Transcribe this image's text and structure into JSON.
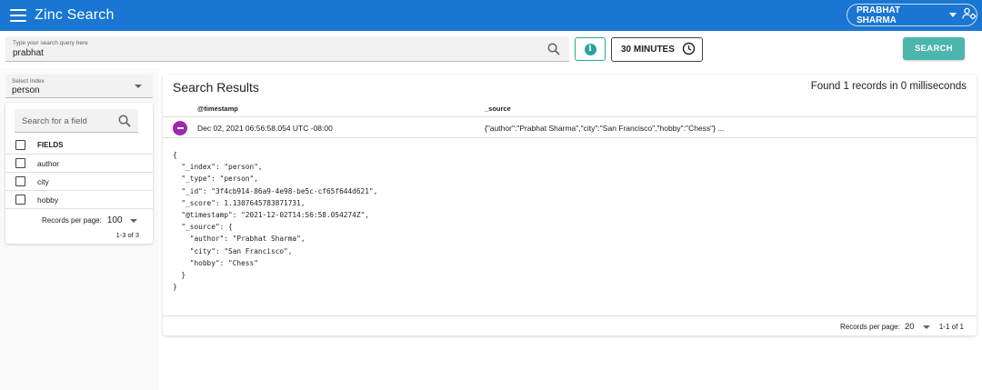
{
  "header": {
    "app_title": "Zinc Search",
    "menu_icon": "hamburger-menu-icon",
    "user_name": "PRABHAT SHARMA",
    "user_icon": "manage-accounts-icon",
    "bar_color": "#1976d2"
  },
  "query": {
    "label": "Type your search query here",
    "value": "prabhat",
    "search_icon": "search-icon"
  },
  "toolbar": {
    "info_icon": "info-icon",
    "info_glyph": "i",
    "time_range": "30 MINUTES",
    "time_icon": "clock-icon",
    "search_label": "SEARCH",
    "accent_color": "#26a69a"
  },
  "index": {
    "label": "Select Index",
    "value": "person"
  },
  "fields": {
    "search_placeholder": "Search for a field",
    "header": "FIELDS",
    "items": [
      "author",
      "city",
      "hobby"
    ],
    "rows_per_page_label": "Records per page:",
    "rows_per_page_value": "100",
    "range": "1-3 of 3"
  },
  "results": {
    "title": "Search Results",
    "found": "Found 1 records in 0 milliseconds",
    "columns": [
      "@timestamp",
      "_source"
    ],
    "rows": [
      {
        "timestamp": "Dec 02, 2021 06:56:58.054 UTC -08:00",
        "source": "{\"author\":\"Prabhat Sharma\",\"city\":\"San Francisco\",\"hobby\":\"Chess\"} ..."
      }
    ],
    "expanded_json": "{\n  \"_index\": \"person\",\n  \"_type\": \"person\",\n  \"_id\": \"3f4cb914-86a9-4e98-be5c-cf65f644d621\",\n  \"_score\": 1.1307645783871731,\n  \"@timestamp\": \"2021-12-02T14:56:58.054274Z\",\n  \"_source\": {\n    \"author\": \"Prabhat Sharma\",\n    \"city\": \"San Francisco\",\n    \"hobby\": \"Chess\"\n  }\n}",
    "collapse_color": "#9c27b0",
    "rows_per_page_label": "Records per page:",
    "rows_per_page_value": "20",
    "range": "1-1 of 1"
  }
}
